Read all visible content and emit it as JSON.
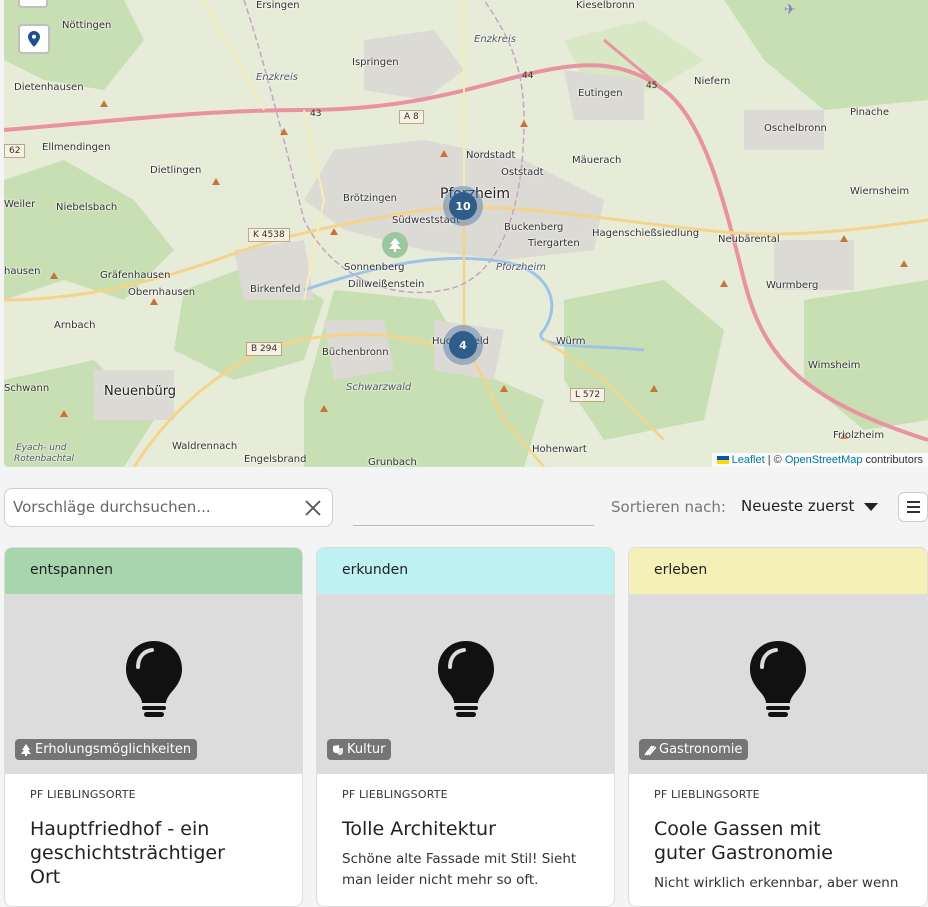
{
  "map": {
    "labels": {
      "noettingen": "Nöttingen",
      "ersingen": "Ersingen",
      "kieselbronn": "Kieselbronn",
      "dietenhausen": "Dietenhausen",
      "enzkreis1": "Enzkreis",
      "enzkreis2": "Enzkreis",
      "ispringen": "Ispringen",
      "eutingen": "Eutingen",
      "niefern": "Niefern",
      "pinache": "Pinache",
      "oschelbronn": "Oschelbronn",
      "ellmendingen": "Ellmendingen",
      "nordstadt": "Nordstadt",
      "oststadt": "Oststadt",
      "maeuerach": "Mäuerach",
      "dietlingen": "Dietlingen",
      "pforzheim": "Pforzheim",
      "weiler": "Weiler",
      "niebelsbach": "Niebelsbach",
      "broetzingen": "Brötzingen",
      "suedweststadt": "Südweststadt",
      "buckenberg": "Buckenberg",
      "tiergarten": "Tiergarten",
      "hagenschiess": "Hagenschießsiedlung",
      "neubaerental": "Neubärental",
      "wiernsheim": "Wiernsheim",
      "sonnenberg": "Sonnenberg",
      "pforzheim_ital": "Pforzheim",
      "hausen": "hausen",
      "graefenhausen": "Gräfenhausen",
      "birkenfeld": "Birkenfeld",
      "dillweissenstein": "Dillweißenstein",
      "wurmberg": "Wurmberg",
      "obernhausen": "Obernhausen",
      "arnbach": "Arnbach",
      "huchenfeld": "Huchenfeld",
      "wuerm": "Würm",
      "buechenbronn": "Büchenbronn",
      "wimsheim": "Wimsheim",
      "schwann": "Schwann",
      "neuenbuerg": "Neuenbürg",
      "schwarzwald": "Schwarzwald",
      "waldrennach": "Waldrennach",
      "friolzheim": "Friolzheim",
      "eyach": "Eyach- und",
      "rotenbachtal": "Rotenbachtal",
      "engelsbrand": "Engelsbrand",
      "grunbach": "Grunbach",
      "hohenwart": "Hohenwart"
    },
    "shields": {
      "a8": "A 8",
      "r43": "43",
      "r44": "44",
      "r45": "45",
      "r62": "62",
      "k4538": "K 4538",
      "b294": "B 294",
      "l572": "L 572"
    },
    "clusters": {
      "north": "10",
      "south": "4"
    },
    "attribution": {
      "leaflet": "Leaflet",
      "sep": " | © ",
      "osm": "OpenStreetMap",
      "contrib": " contributors"
    }
  },
  "toolbar": {
    "search_placeholder": "Vorschläge durchsuchen...",
    "sort_label": "Sortieren nach:",
    "sort_value": "Neueste zuerst"
  },
  "cards": [
    {
      "category": "entspannen",
      "category_color": "#a8d5ad",
      "badge": "Erholungsmöglichkeiten",
      "source": "PF LIEBLINGSORTE",
      "title": "Hauptfriedhof - ein geschichtsträchtiger Ort",
      "description": ""
    },
    {
      "category": "erkunden",
      "category_color": "#bdf1f2",
      "badge": "Kultur",
      "source": "PF LIEBLINGSORTE",
      "title": "Tolle Architektur",
      "description": "Schöne alte Fassade mit Stil! Sieht man leider nicht mehr so oft."
    },
    {
      "category": "erleben",
      "category_color": "#f5f0b8",
      "badge": "Gastronomie",
      "source": "PF LIEBLINGSORTE",
      "title": "Coole Gassen mit guter Gastronomie",
      "description": "Nicht wirklich erkennbar, aber wenn"
    }
  ]
}
